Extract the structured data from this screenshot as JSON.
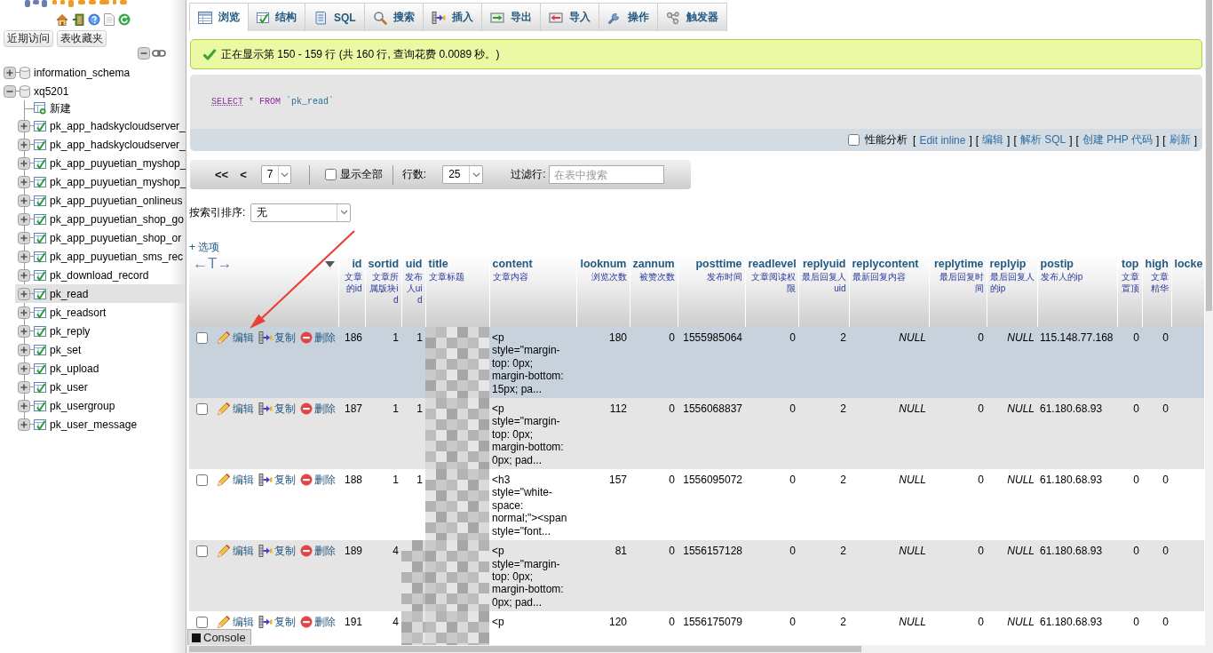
{
  "sidebar": {
    "buttons": [
      {
        "label": "近期访问"
      },
      {
        "label": "表收藏夹"
      }
    ],
    "tree": [
      {
        "name": "information_schema",
        "kind": "database",
        "expanded": false,
        "selected": false
      },
      {
        "name": "xq5201",
        "kind": "database",
        "expanded": true,
        "selected": false,
        "children": [
          {
            "name": "新建",
            "kind": "new",
            "selected": false
          },
          {
            "name": "pk_app_hadskycloudserver_",
            "kind": "table",
            "expanded": false,
            "selected": false
          },
          {
            "name": "pk_app_hadskycloudserver_",
            "kind": "table",
            "expanded": false,
            "selected": false
          },
          {
            "name": "pk_app_puyuetian_myshop_",
            "kind": "table",
            "expanded": false,
            "selected": false
          },
          {
            "name": "pk_app_puyuetian_myshop_",
            "kind": "table",
            "expanded": false,
            "selected": false
          },
          {
            "name": "pk_app_puyuetian_onlineus",
            "kind": "table",
            "expanded": false,
            "selected": false
          },
          {
            "name": "pk_app_puyuetian_shop_go",
            "kind": "table",
            "expanded": false,
            "selected": false
          },
          {
            "name": "pk_app_puyuetian_shop_or",
            "kind": "table",
            "expanded": false,
            "selected": false
          },
          {
            "name": "pk_app_puyuetian_sms_rec",
            "kind": "table",
            "expanded": false,
            "selected": false
          },
          {
            "name": "pk_download_record",
            "kind": "table",
            "expanded": false,
            "selected": false
          },
          {
            "name": "pk_read",
            "kind": "table",
            "expanded": false,
            "selected": true
          },
          {
            "name": "pk_readsort",
            "kind": "table",
            "expanded": false,
            "selected": false
          },
          {
            "name": "pk_reply",
            "kind": "table",
            "expanded": false,
            "selected": false
          },
          {
            "name": "pk_set",
            "kind": "table",
            "expanded": false,
            "selected": false
          },
          {
            "name": "pk_upload",
            "kind": "table",
            "expanded": false,
            "selected": false
          },
          {
            "name": "pk_user",
            "kind": "table",
            "expanded": false,
            "selected": false
          },
          {
            "name": "pk_usergroup",
            "kind": "table",
            "expanded": false,
            "selected": false
          },
          {
            "name": "pk_user_message",
            "kind": "table",
            "expanded": false,
            "selected": false
          }
        ]
      }
    ]
  },
  "tabs": [
    {
      "label": "浏览",
      "kind": "browse",
      "selected": true
    },
    {
      "label": "结构",
      "kind": "structure",
      "selected": false
    },
    {
      "label": "SQL",
      "kind": "sql",
      "selected": false
    },
    {
      "label": "搜索",
      "kind": "search",
      "selected": false
    },
    {
      "label": "插入",
      "kind": "insert",
      "selected": false
    },
    {
      "label": "导出",
      "kind": "export",
      "selected": false
    },
    {
      "label": "导入",
      "kind": "import",
      "selected": false
    },
    {
      "label": "操作",
      "kind": "operations",
      "selected": false
    },
    {
      "label": "触发器",
      "kind": "triggers",
      "selected": false
    }
  ],
  "message": {
    "text": "正在显示第 150 - 159 行 (共 160 行, 查询花费 0.0089 秒。)"
  },
  "sql": {
    "tokens": [
      {
        "text": "SELECT",
        "kind": "keyword_link"
      },
      {
        "text": "*",
        "kind": "operator"
      },
      {
        "text": "FROM",
        "kind": "keyword"
      },
      {
        "text": "`pk_read`",
        "kind": "identifier"
      }
    ],
    "profiling": {
      "label": "性能分析",
      "checked": false
    },
    "links": [
      {
        "open": "[",
        "label": "Edit inline",
        "close": "]"
      },
      {
        "open": "[",
        "label": "编辑",
        "close": "]"
      },
      {
        "open": "[",
        "label": "解析 SQL",
        "close": "]"
      },
      {
        "open": "[",
        "label": "创建 PHP 代码",
        "close": "]"
      },
      {
        "open": "[",
        "label": "刷新",
        "close": "]"
      }
    ]
  },
  "navigation": {
    "first": "<<",
    "previous": "<",
    "page": "7",
    "show_all": {
      "label": "显示全部",
      "checked": false
    },
    "rows_label": "行数:",
    "rows": "25",
    "filter": {
      "label": "过滤行:",
      "placeholder": "在表中搜索"
    }
  },
  "sort": {
    "label": "按索引排序:",
    "value": "无"
  },
  "options": {
    "label": "+ 选项"
  },
  "table": {
    "toggle": "←T→",
    "columns": [
      {
        "name": "id",
        "comment": "文章的id",
        "kind": "number"
      },
      {
        "name": "sortid",
        "comment": "文章所属版块id",
        "kind": "number"
      },
      {
        "name": "uid",
        "comment": "发布人uid",
        "kind": "number"
      },
      {
        "name": "title",
        "comment": "文章标题",
        "kind": "long_text"
      },
      {
        "name": "content",
        "comment": "文章内容",
        "kind": "long_text"
      },
      {
        "name": "looknum",
        "comment": "浏览次数",
        "kind": "number"
      },
      {
        "name": "zannum",
        "comment": "被赞次数",
        "kind": "number"
      },
      {
        "name": "posttime",
        "comment": "发布时间",
        "kind": "number"
      },
      {
        "name": "readlevel",
        "comment": "文章阅读权限",
        "kind": "number"
      },
      {
        "name": "replyuid",
        "comment": "最后回复人uid",
        "kind": "number"
      },
      {
        "name": "replycontent",
        "comment": "最新回复内容",
        "kind": "long_text"
      },
      {
        "name": "replytime",
        "comment": "最后回复时间",
        "kind": "number"
      },
      {
        "name": "replyip",
        "comment": "最后回复人的ip",
        "kind": "text"
      },
      {
        "name": "postip",
        "comment": "发布人的ip",
        "kind": "text"
      },
      {
        "name": "top",
        "comment": "文章置顶",
        "kind": "number"
      },
      {
        "name": "high",
        "comment": "文章精华",
        "kind": "number"
      },
      {
        "name": "locke",
        "kind": "text"
      }
    ],
    "rows": [
      {
        "checked": false,
        "highlighted": true,
        "actions": [
          {
            "label": "编辑",
            "kind": "edit"
          },
          {
            "label": "复制",
            "kind": "copy"
          },
          {
            "label": "删除",
            "kind": "delete"
          }
        ],
        "cells": [
          {
            "kind": "value",
            "text": "186"
          },
          {
            "kind": "value",
            "text": "1"
          },
          {
            "kind": "value",
            "text": "1"
          },
          {
            "kind": "pixelated"
          },
          {
            "kind": "value",
            "text": "<p style=\"margin-top: 0px; margin-bottom: 15px; pa..."
          },
          {
            "kind": "value",
            "text": "180"
          },
          {
            "kind": "value",
            "text": "0"
          },
          {
            "kind": "value",
            "text": "1555985064"
          },
          {
            "kind": "value",
            "text": "0"
          },
          {
            "kind": "value",
            "text": "2"
          },
          {
            "kind": "null",
            "text": "NULL"
          },
          {
            "kind": "value",
            "text": "0"
          },
          {
            "kind": "null",
            "text": "NULL"
          },
          {
            "kind": "value",
            "text": "115.148.77.168"
          },
          {
            "kind": "value",
            "text": "0"
          },
          {
            "kind": "value",
            "text": "0"
          }
        ]
      },
      {
        "checked": false,
        "highlighted": false,
        "actions": [
          {
            "label": "编辑",
            "kind": "edit"
          },
          {
            "label": "复制",
            "kind": "copy"
          },
          {
            "label": "删除",
            "kind": "delete"
          }
        ],
        "cells": [
          {
            "kind": "value",
            "text": "187"
          },
          {
            "kind": "value",
            "text": "1"
          },
          {
            "kind": "value",
            "text": "1"
          },
          {
            "kind": "pixelated"
          },
          {
            "kind": "value",
            "text": "<p style=\"margin-top: 0px; margin-bottom: 0px; pad..."
          },
          {
            "kind": "value",
            "text": "112"
          },
          {
            "kind": "value",
            "text": "0"
          },
          {
            "kind": "value",
            "text": "1556068837"
          },
          {
            "kind": "value",
            "text": "0"
          },
          {
            "kind": "value",
            "text": "2"
          },
          {
            "kind": "null",
            "text": "NULL"
          },
          {
            "kind": "value",
            "text": "0"
          },
          {
            "kind": "null",
            "text": "NULL"
          },
          {
            "kind": "value",
            "text": "61.180.68.93"
          },
          {
            "kind": "value",
            "text": "0"
          },
          {
            "kind": "value",
            "text": "0"
          }
        ]
      },
      {
        "checked": false,
        "highlighted": false,
        "actions": [
          {
            "label": "编辑",
            "kind": "edit"
          },
          {
            "label": "复制",
            "kind": "copy"
          },
          {
            "label": "删除",
            "kind": "delete"
          }
        ],
        "cells": [
          {
            "kind": "value",
            "text": "188"
          },
          {
            "kind": "value",
            "text": "1"
          },
          {
            "kind": "value",
            "text": "1"
          },
          {
            "kind": "pixelated"
          },
          {
            "kind": "value",
            "text": "<h3 style=\"white-space: normal;\"><span style=\"font..."
          },
          {
            "kind": "value",
            "text": "157"
          },
          {
            "kind": "value",
            "text": "0"
          },
          {
            "kind": "value",
            "text": "1556095072"
          },
          {
            "kind": "value",
            "text": "0"
          },
          {
            "kind": "value",
            "text": "2"
          },
          {
            "kind": "null",
            "text": "NULL"
          },
          {
            "kind": "value",
            "text": "0"
          },
          {
            "kind": "null",
            "text": "NULL"
          },
          {
            "kind": "value",
            "text": "61.180.68.93"
          },
          {
            "kind": "value",
            "text": "0"
          },
          {
            "kind": "value",
            "text": "0"
          }
        ]
      },
      {
        "checked": false,
        "highlighted": false,
        "actions": [
          {
            "label": "编辑",
            "kind": "edit"
          },
          {
            "label": "复制",
            "kind": "copy"
          },
          {
            "label": "删除",
            "kind": "delete"
          }
        ],
        "cells": [
          {
            "kind": "value",
            "text": "189"
          },
          {
            "kind": "value",
            "text": "4"
          },
          {
            "kind": "pixelated"
          },
          {
            "kind": "pixelated"
          },
          {
            "kind": "value",
            "text": "<p style=\"margin-top: 0px; margin-bottom: 0px; pad..."
          },
          {
            "kind": "value",
            "text": "81"
          },
          {
            "kind": "value",
            "text": "0"
          },
          {
            "kind": "value",
            "text": "1556157128"
          },
          {
            "kind": "value",
            "text": "0"
          },
          {
            "kind": "value",
            "text": "2"
          },
          {
            "kind": "null",
            "text": "NULL"
          },
          {
            "kind": "value",
            "text": "0"
          },
          {
            "kind": "null",
            "text": "NULL"
          },
          {
            "kind": "value",
            "text": "61.180.68.93"
          },
          {
            "kind": "value",
            "text": "0"
          },
          {
            "kind": "value",
            "text": "0"
          }
        ]
      },
      {
        "checked": false,
        "highlighted": false,
        "actions": [
          {
            "label": "编辑",
            "kind": "edit"
          },
          {
            "label": "复制",
            "kind": "copy"
          },
          {
            "label": "删除",
            "kind": "delete"
          }
        ],
        "cells": [
          {
            "kind": "value",
            "text": "191"
          },
          {
            "kind": "value",
            "text": "4"
          },
          {
            "kind": "pixelated"
          },
          {
            "kind": "pixelated"
          },
          {
            "kind": "value",
            "text": "<p"
          },
          {
            "kind": "value",
            "text": "120"
          },
          {
            "kind": "value",
            "text": "0"
          },
          {
            "kind": "value",
            "text": "1556175079"
          },
          {
            "kind": "value",
            "text": "0"
          },
          {
            "kind": "value",
            "text": "2"
          },
          {
            "kind": "null",
            "text": "NULL"
          },
          {
            "kind": "value",
            "text": "0"
          },
          {
            "kind": "null",
            "text": "NULL"
          },
          {
            "kind": "value",
            "text": "61.180.68.93"
          },
          {
            "kind": "value",
            "text": "0"
          },
          {
            "kind": "value",
            "text": "0"
          }
        ]
      }
    ]
  },
  "console": {
    "label": "Console"
  }
}
